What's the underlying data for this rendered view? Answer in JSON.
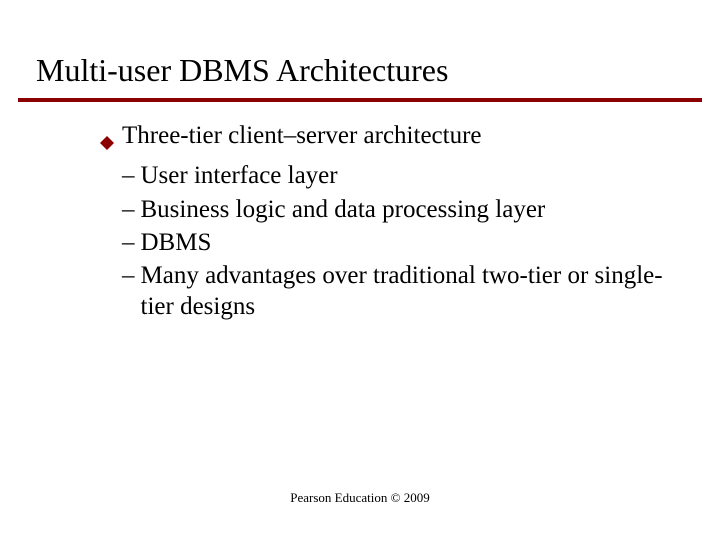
{
  "title": "Multi-user DBMS Architectures",
  "bullet": {
    "text": "Three-tier client–server architecture",
    "subs": [
      "User interface layer",
      "Business logic and data processing layer",
      "DBMS",
      "Many advantages over traditional two-tier or single-tier designs"
    ]
  },
  "footer": "Pearson Education © 2009",
  "colors": {
    "accent": "#8b0000"
  }
}
